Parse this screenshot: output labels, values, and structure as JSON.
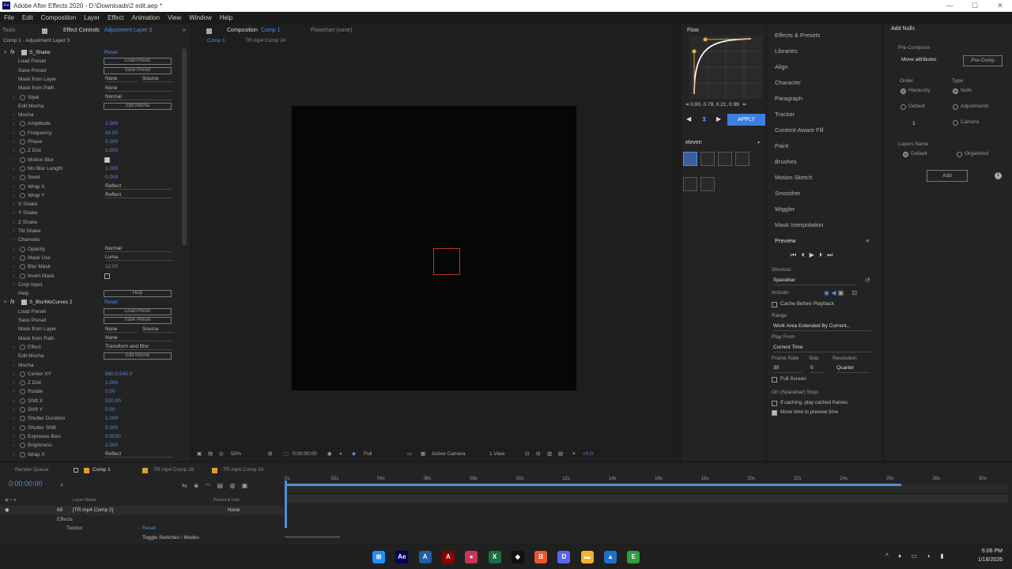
{
  "window": {
    "title": "Adobe After Effects 2020 - D:\\Downloads\\2 edit.aep *",
    "controls": [
      "—",
      "☐",
      "✕"
    ]
  },
  "menu": [
    "File",
    "Edit",
    "Composition",
    "Layer",
    "Effect",
    "Animation",
    "View",
    "Window",
    "Help"
  ],
  "effect_controls": {
    "tools_label": "Tools",
    "tab_title": "Effect Controls",
    "tab_layer": "Adjustment Layer 3",
    "breadcrumb": "Comp 1 · Adjustment Layer 3",
    "rows": [
      {
        "type": "fx",
        "label": "S_Shake",
        "reset": "Reset"
      },
      {
        "type": "button",
        "label": "Load Preset",
        "button": "Load Preset"
      },
      {
        "type": "button",
        "label": "Save Preset",
        "button": "Save Preset"
      },
      {
        "type": "dd2",
        "label": "Mask from Layer",
        "value": "None",
        "value2": "Source"
      },
      {
        "type": "dd",
        "label": "Mask from Path",
        "value": "None"
      },
      {
        "type": "dd",
        "label": "Style",
        "value": "Normal",
        "sw": true
      },
      {
        "type": "button",
        "label": "Edit Mocha",
        "button": "Edit Mocha"
      },
      {
        "type": "group",
        "label": "Mocha"
      },
      {
        "type": "val",
        "label": "Amplitude",
        "value": "1.000",
        "sw": true
      },
      {
        "type": "val",
        "label": "Frequency",
        "value": "50.00",
        "sw": true
      },
      {
        "type": "val",
        "label": "Phase",
        "value": "0.000",
        "sw": true
      },
      {
        "type": "val",
        "label": "Z Dist",
        "value": "1.000",
        "sw": true
      },
      {
        "type": "check",
        "label": "Motion Blur",
        "checked": true,
        "sw": true
      },
      {
        "type": "val",
        "label": "Mo Blur Length",
        "value": "1.000",
        "sw": true
      },
      {
        "type": "val",
        "label": "Seed",
        "value": "0.000",
        "sw": true
      },
      {
        "type": "dd",
        "label": "Wrap X",
        "value": "Reflect",
        "sw": true
      },
      {
        "type": "dd",
        "label": "Wrap Y",
        "value": "Reflect",
        "sw": true
      },
      {
        "type": "group",
        "label": "X Shake"
      },
      {
        "type": "group",
        "label": "Y Shake"
      },
      {
        "type": "group",
        "label": "Z Shake"
      },
      {
        "type": "group",
        "label": "Tilt Shake"
      },
      {
        "type": "group",
        "label": "Channels"
      },
      {
        "type": "dd",
        "label": "Opacity",
        "value": "Normal",
        "sw": true
      },
      {
        "type": "dd",
        "label": "Mask Use",
        "value": "Luma",
        "sw": true
      },
      {
        "type": "val",
        "label": "Blur Mask",
        "value": "12.00",
        "sw": true
      },
      {
        "type": "check",
        "label": "Invert Mask",
        "checked": false,
        "sw": true
      },
      {
        "type": "group",
        "label": "Crop Input"
      },
      {
        "type": "button",
        "label": "Help",
        "button": "Help"
      },
      {
        "type": "fx",
        "label": "S_BlurMoCurves 2",
        "reset": "Reset"
      },
      {
        "type": "button",
        "label": "Load Preset",
        "button": "Load Preset"
      },
      {
        "type": "button",
        "label": "Save Preset",
        "button": "Save Preset"
      },
      {
        "type": "dd2",
        "label": "Mask from Layer",
        "value": "None",
        "value2": "Source"
      },
      {
        "type": "dd",
        "label": "Mask from Path",
        "value": "None"
      },
      {
        "type": "dd",
        "label": "Effect",
        "value": "Transform and Blur",
        "sw": true
      },
      {
        "type": "button",
        "label": "Edit Mocha",
        "button": "Edit Mocha"
      },
      {
        "type": "group",
        "label": "Mocha"
      },
      {
        "type": "val",
        "label": "Center XY",
        "value": "960.0,540.0",
        "sw": true
      },
      {
        "type": "val",
        "label": "Z Dist",
        "value": "1.000",
        "sw": true
      },
      {
        "type": "val",
        "label": "Rotate",
        "value": "0.00",
        "sw": true
      },
      {
        "type": "val",
        "label": "Shift X",
        "value": "510.00",
        "sw": true
      },
      {
        "type": "val",
        "label": "Shift Y",
        "value": "0.00",
        "sw": true
      },
      {
        "type": "val",
        "label": "Shutter Duration",
        "value": "1.000",
        "sw": true
      },
      {
        "type": "val",
        "label": "Shutter Shift",
        "value": "0.000",
        "sw": true
      },
      {
        "type": "val",
        "label": "Exposure Bias",
        "value": "0.5000",
        "sw": true
      },
      {
        "type": "val",
        "label": "Brightness",
        "value": "1.000",
        "sw": true
      },
      {
        "type": "dd",
        "label": "Wrap X",
        "value": "Reflect",
        "sw": true
      }
    ]
  },
  "composition": {
    "tab": "Composition",
    "tab_comp": "Comp 1",
    "flowchart": "Flowchart (none)",
    "subtabs": [
      "Comp 1",
      "TR.mp4 Comp 24"
    ],
    "zoom": "50%",
    "timecode": "0:00:00:00",
    "resolution": "Full",
    "camera": "Active Camera",
    "view": "1 View",
    "exposure": "+0.0"
  },
  "flow": {
    "title": "Flow",
    "values": "0.00, 0.79, 0.21, 0.99",
    "apply": "APPLY",
    "preset_name": "eleven"
  },
  "side_panels": [
    "Effects & Presets",
    "Libraries",
    "Align",
    "Character",
    "Paragraph",
    "Tracker",
    "Content-Aware Fill",
    "Paint",
    "Brushes",
    "Motion Sketch",
    "Smoother",
    "Wiggler",
    "Mask Interpolation"
  ],
  "preview": {
    "title": "Preview",
    "shortcut_label": "Shortcut",
    "shortcut": "Spacebar",
    "include_label": "Include:",
    "cache_before": "Cache Before Playback",
    "range_label": "Range",
    "range": "Work Area Extended By Current...",
    "play_from_label": "Play From",
    "play_from": "Current Time",
    "frame_rate_label": "Frame Rate",
    "skip_label": "Skip",
    "resolution_label": "Resolution",
    "frame_rate": "30",
    "skip": "0",
    "resolution": "Quarter",
    "full_screen": "Full Screen",
    "on_stop": "On (Spacebar) Stop:",
    "if_caching": "If caching, play cached frames",
    "move_time": "Move time to preview time"
  },
  "add_nulls": {
    "title": "Add Nulls",
    "precompose_label": "Pre-Compose",
    "move_attributes": "Move attributes",
    "precomp_button": "Pre-Comp",
    "order_label": "Order",
    "type_label": "Type",
    "hierarchy": "Hierarchy",
    "default": "Default",
    "nulls": "Nulls",
    "adjustments": "Adjustments",
    "camera": "Camera",
    "count": "1",
    "layers_name_label": "Layers Name",
    "default2": "Default",
    "organized": "Organized",
    "add_button": "Add",
    "info": "i"
  },
  "timeline": {
    "tabs": [
      "Render Queue",
      "Comp 1",
      "TR.mp4 Comp 28",
      "TR.mp4 Comp 24"
    ],
    "timecode": "0:00:00:00",
    "col_layer_name": "Layer Name",
    "col_parent": "Parent & Link",
    "layer_num": "68",
    "layer_name": "[TR.mp4 Comp 2]",
    "parent": "None",
    "effects": "Effects",
    "twixtor": "Twixtor",
    "reset": "Reset",
    "toggle": "Toggle Switches / Modes",
    "ruler": [
      "0s",
      "02s",
      "04s",
      "06s",
      "08s",
      "10s",
      "12s",
      "14s",
      "16s",
      "18s",
      "20s",
      "22s",
      "24s",
      "26s",
      "28s",
      "30s"
    ]
  },
  "taskbar": {
    "icons": [
      {
        "name": "windows-start-icon",
        "glyph": "⊞",
        "color": "#1e90ff"
      },
      {
        "name": "after-effects-icon",
        "glyph": "Ae",
        "color": "#00005b"
      },
      {
        "name": "affinity-icon",
        "glyph": "A",
        "color": "#1e5fa8"
      },
      {
        "name": "adobe-red-icon",
        "glyph": "A",
        "color": "#8b0000"
      },
      {
        "name": "browser-icon",
        "glyph": "●",
        "color": "#cc3355"
      },
      {
        "name": "excel-icon",
        "glyph": "X",
        "color": "#1d6f42"
      },
      {
        "name": "capcut-icon",
        "glyph": "◆",
        "color": "#111111"
      },
      {
        "name": "brave-icon",
        "glyph": "B",
        "color": "#f0562a"
      },
      {
        "name": "discord-icon",
        "glyph": "D",
        "color": "#5865f2"
      },
      {
        "name": "file-explorer-icon",
        "glyph": "▬",
        "color": "#f2b32a"
      },
      {
        "name": "photos-icon",
        "glyph": "▲",
        "color": "#1a73c8"
      },
      {
        "name": "green-app-icon",
        "glyph": "E",
        "color": "#2e9e3e"
      }
    ],
    "time": "6:06 PM",
    "date": "1/18/2026"
  }
}
